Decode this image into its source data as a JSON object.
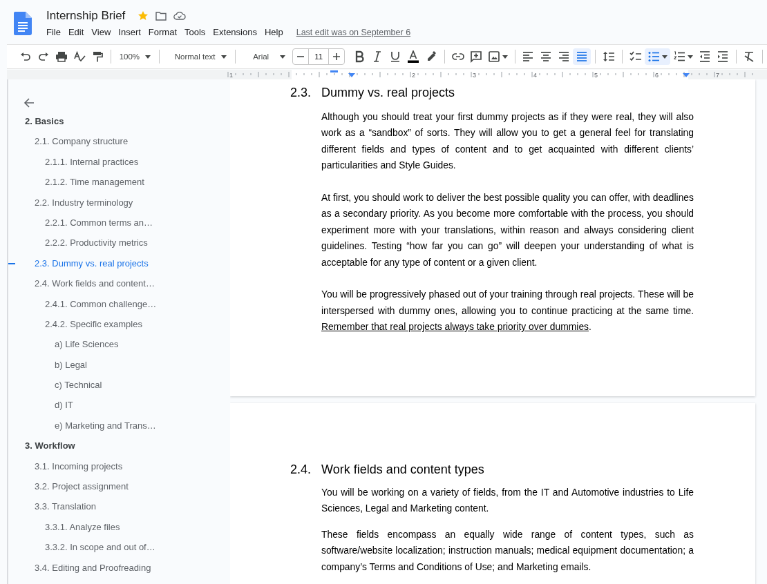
{
  "document": {
    "title": "Internship Brief",
    "starred": true
  },
  "menu": [
    "File",
    "Edit",
    "View",
    "Insert",
    "Format",
    "Tools",
    "Extensions",
    "Help"
  ],
  "last_edit": "Last edit was on September 6",
  "toolbar": {
    "zoom": "100%",
    "style": "Normal text",
    "font": "Arial",
    "font_size": "11",
    "alignments": [
      {
        "kind": "left",
        "selected": false
      },
      {
        "kind": "center",
        "selected": false
      },
      {
        "kind": "right",
        "selected": false
      },
      {
        "kind": "justify",
        "selected": true
      }
    ],
    "lists": [
      {
        "kind": "checklist",
        "selected": false
      },
      {
        "kind": "bulleted",
        "selected": true
      },
      {
        "kind": "numbered",
        "selected": false
      }
    ]
  },
  "ruler": {
    "labels": [
      "1",
      "2",
      "3",
      "4",
      "5",
      "6",
      "7"
    ]
  },
  "outline": [
    {
      "text": "2. Basics",
      "selected": false,
      "children": [
        {
          "text": "2.1. Company structure",
          "selected": false,
          "children": [
            {
              "text": "2.1.1. Internal practices",
              "selected": false
            },
            {
              "text": "2.1.2. Time management",
              "selected": false
            }
          ]
        },
        {
          "text": "2.2. Industry terminology",
          "selected": false,
          "children": [
            {
              "text": "2.2.1. Common terms an…",
              "selected": false
            },
            {
              "text": "2.2.2. Productivity metrics",
              "selected": false
            }
          ]
        },
        {
          "text": "2.3. Dummy vs. real projects",
          "selected": true
        },
        {
          "text": "2.4. Work fields and content…",
          "selected": false,
          "children": [
            {
              "text": "2.4.1. Common challenge…",
              "selected": false
            },
            {
              "text": "2.4.2. Specific examples",
              "selected": false,
              "children": [
                {
                  "text": "a) Life Sciences",
                  "selected": false
                },
                {
                  "text": "b) Legal",
                  "selected": false
                },
                {
                  "text": "c) Technical",
                  "selected": false
                },
                {
                  "text": "d) IT",
                  "selected": false
                },
                {
                  "text": "e) Marketing and Trans…",
                  "selected": false
                }
              ]
            }
          ]
        }
      ]
    },
    {
      "text": "3. Workflow",
      "selected": false,
      "children": [
        {
          "text": "3.1. Incoming projects",
          "selected": false
        },
        {
          "text": "3.2. Project assignment",
          "selected": false
        },
        {
          "text": "3.3. Translation",
          "selected": false,
          "children": [
            {
              "text": "3.3.1. Analyze files",
              "selected": false
            },
            {
              "text": "3.3.2. In scope and out of…",
              "selected": false
            }
          ]
        },
        {
          "text": "3.4. Editing and Proofreading",
          "selected": false
        }
      ]
    }
  ],
  "pages": [
    {
      "sections": [
        {
          "number": "2.3.",
          "title": "Dummy vs. real projects",
          "paragraphs": [
            {
              "runs": [
                {
                  "text": "Although you should treat your first dummy projects as if they were real, they will also work as a “sandbox” of sorts. They will allow you to get a general feel for translating different fields and types of content and to get acquainted with different clients’ particularities and Style Guides.",
                  "underline": false
                }
              ]
            },
            {
              "runs": [
                {
                  "text": "At first, you should work to deliver the best possible quality you can offer, with deadlines as a secondary priority. As you become more comfortable with the process, you should experiment more with your translations, within reason and always considering client guidelines. Testing “how far you can go” will deepen your understanding of what is acceptable for any type of content or a given client.",
                  "underline": false
                }
              ]
            },
            {
              "runs": [
                {
                  "text": "You will be progressively phased out of your training through real projects. These will be interspersed with dummy ones, allowing you to continue practicing at the same time. ",
                  "underline": false
                },
                {
                  "text": "Remember that real projects always take priority over dummies",
                  "underline": true
                },
                {
                  "text": ".",
                  "underline": false
                }
              ]
            }
          ]
        }
      ]
    },
    {
      "sections": [
        {
          "number": "2.4.",
          "title": "Work fields and content types",
          "paragraphs": [
            {
              "runs": [
                {
                  "text": "You will be working on a variety of fields, from the IT and Automotive industries to Life Sciences, Legal and Marketing content.",
                  "underline": false
                }
              ]
            },
            {
              "runs": [
                {
                  "text": "These fields encompass an equally wide range of content types, such as software/website localization; instruction manuals; medical equipment documentation; a company’s Terms and Conditions of Use; and Marketing emails.",
                  "underline": false
                }
              ]
            }
          ]
        }
      ]
    }
  ]
}
